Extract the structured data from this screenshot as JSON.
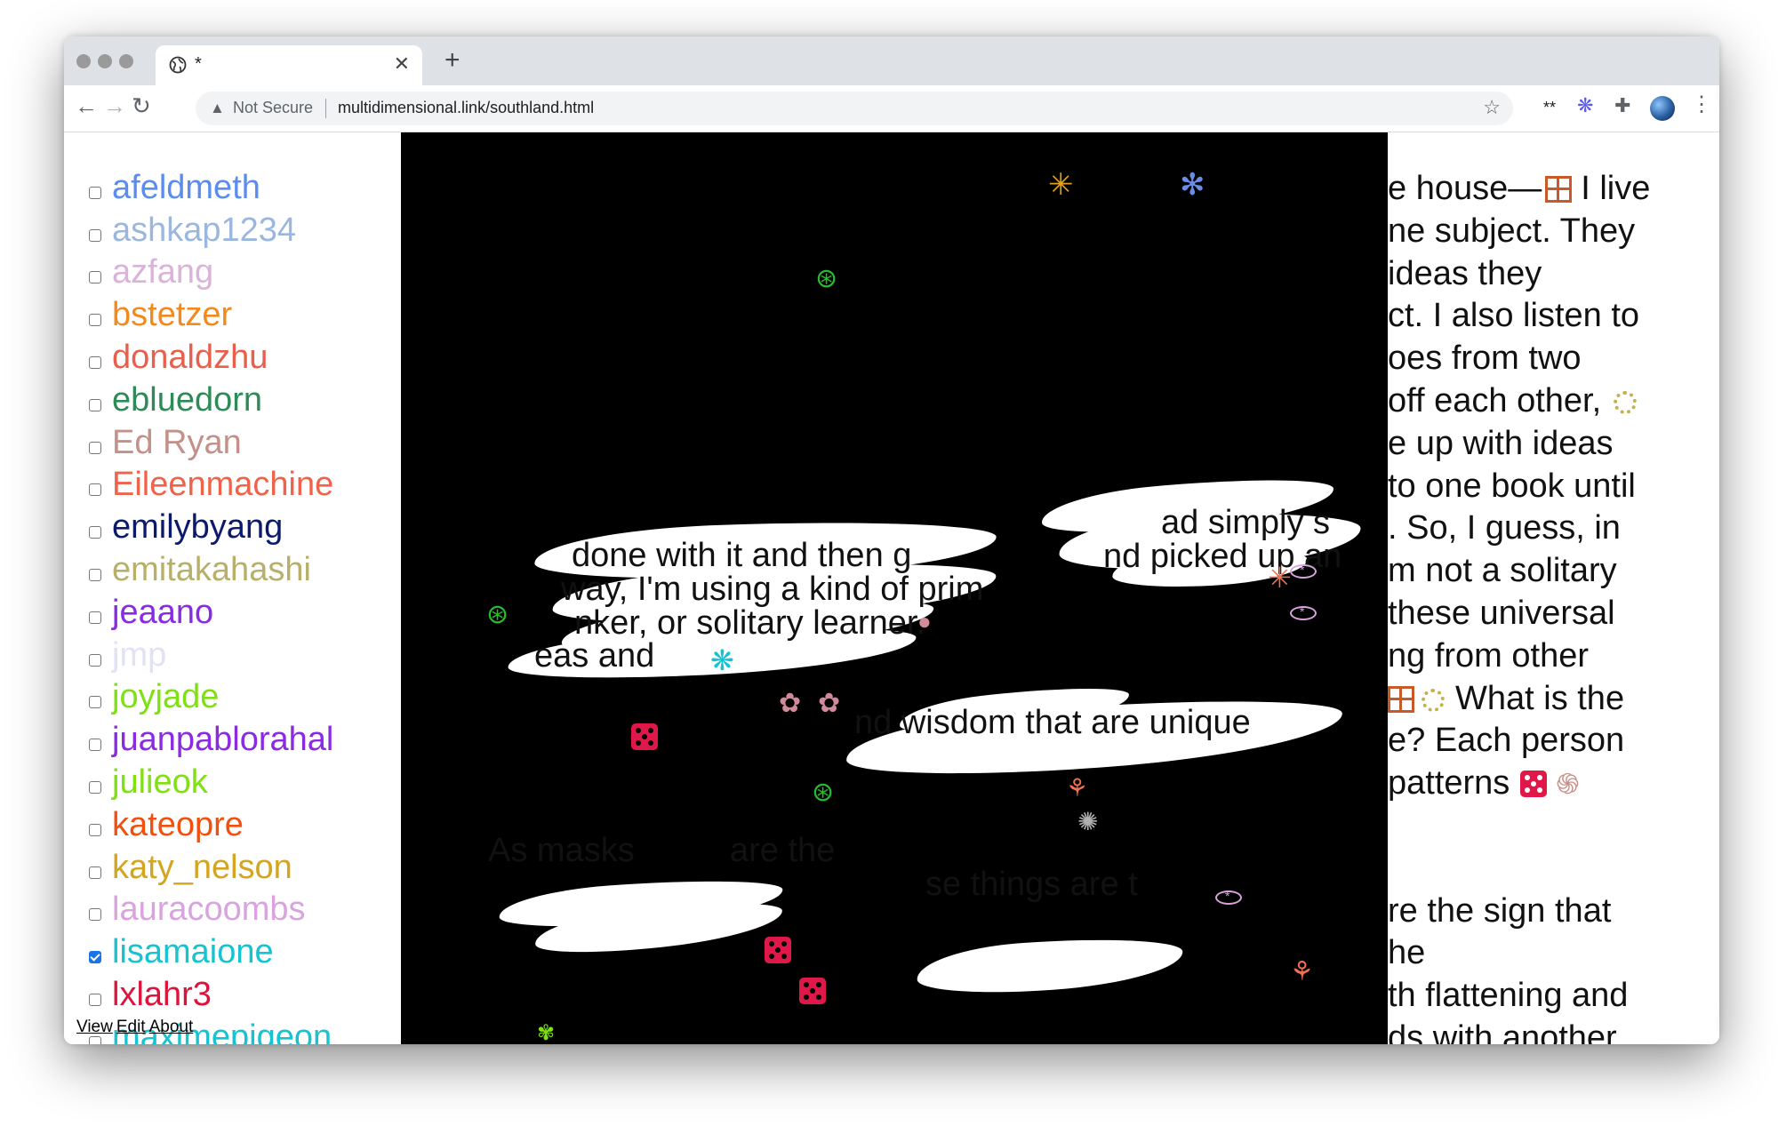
{
  "browser": {
    "tab_title": "*",
    "security_label": "Not Secure",
    "url": "multidimensional.link/southland.html"
  },
  "icons": {
    "back": "arrow-left-icon",
    "forward": "arrow-right-icon",
    "reload": "reload-icon",
    "warning": "warning-icon",
    "bookmark": "star-icon",
    "extensions": "puzzle-icon",
    "profile": "avatar",
    "menu": "kebab-menu-icon"
  },
  "users": [
    {
      "name": "afeldmeth",
      "color": "#5b8def",
      "checked": false
    },
    {
      "name": "ashkap1234",
      "color": "#9bb7de",
      "checked": false
    },
    {
      "name": "azfang",
      "color": "#d9b3d9",
      "checked": false
    },
    {
      "name": "bstetzer",
      "color": "#f28a1e",
      "checked": false
    },
    {
      "name": "donaldzhu",
      "color": "#e8604c",
      "checked": false
    },
    {
      "name": "ebluedorn",
      "color": "#2e8b57",
      "checked": false
    },
    {
      "name": "Ed Ryan",
      "color": "#c4908a",
      "checked": false
    },
    {
      "name": "Eileenmachine",
      "color": "#f0634a",
      "checked": false
    },
    {
      "name": "emilybyang",
      "color": "#0c1a6b",
      "checked": false
    },
    {
      "name": "emitakahashi",
      "color": "#b8b06a",
      "checked": false
    },
    {
      "name": "jeaano",
      "color": "#8a2be2",
      "checked": false
    },
    {
      "name": "jmp",
      "color": "#e2e2f5",
      "checked": false
    },
    {
      "name": "joyjade",
      "color": "#7fe012",
      "checked": false
    },
    {
      "name": "juanpablorahal",
      "color": "#8a2be2",
      "checked": false
    },
    {
      "name": "julieok",
      "color": "#7fe012",
      "checked": false
    },
    {
      "name": "kateopre",
      "color": "#f2500f",
      "checked": false
    },
    {
      "name": "katy_nelson",
      "color": "#d4a520",
      "checked": false
    },
    {
      "name": "lauracoombs",
      "color": "#d9a3e0",
      "checked": false
    },
    {
      "name": "lisamaione",
      "color": "#17c3d1",
      "checked": true
    },
    {
      "name": "lxlahr3",
      "color": "#dc143c",
      "checked": false
    },
    {
      "name": "maximepigeon",
      "color": "#17c3d1",
      "checked": false
    }
  ],
  "footer": {
    "view": "View",
    "edit": "Edit",
    "about": "About"
  },
  "right_text": [
    "e house—",
    "ne subject. They",
    "ideas they",
    "ct. I also listen to",
    "oes from two",
    "off each other,",
    "e up with ideas",
    "to one book until",
    ". So, I guess, in",
    "m not a solitary",
    "these universal",
    "ng from other",
    "",
    "e? Each person",
    "patterns",
    "",
    "",
    "re the sign that",
    "he",
    "th flattening and",
    "ds with another"
  ],
  "right_text_extra": {
    "line0_tail": "I live",
    "line12_tail": "What is the"
  },
  "scribbles": [
    {
      "text": "done with it and then g"
    },
    {
      "text": "nd picked up an"
    },
    {
      "text": "ad simply s"
    },
    {
      "text": "way, I'm using a kind of prim"
    },
    {
      "text": "nker, or solitary learner."
    },
    {
      "text": "eas and"
    },
    {
      "text": "nd wisdom that are unique"
    },
    {
      "text": "As masks"
    },
    {
      "text": "are the"
    },
    {
      "text": "se things are t"
    }
  ]
}
